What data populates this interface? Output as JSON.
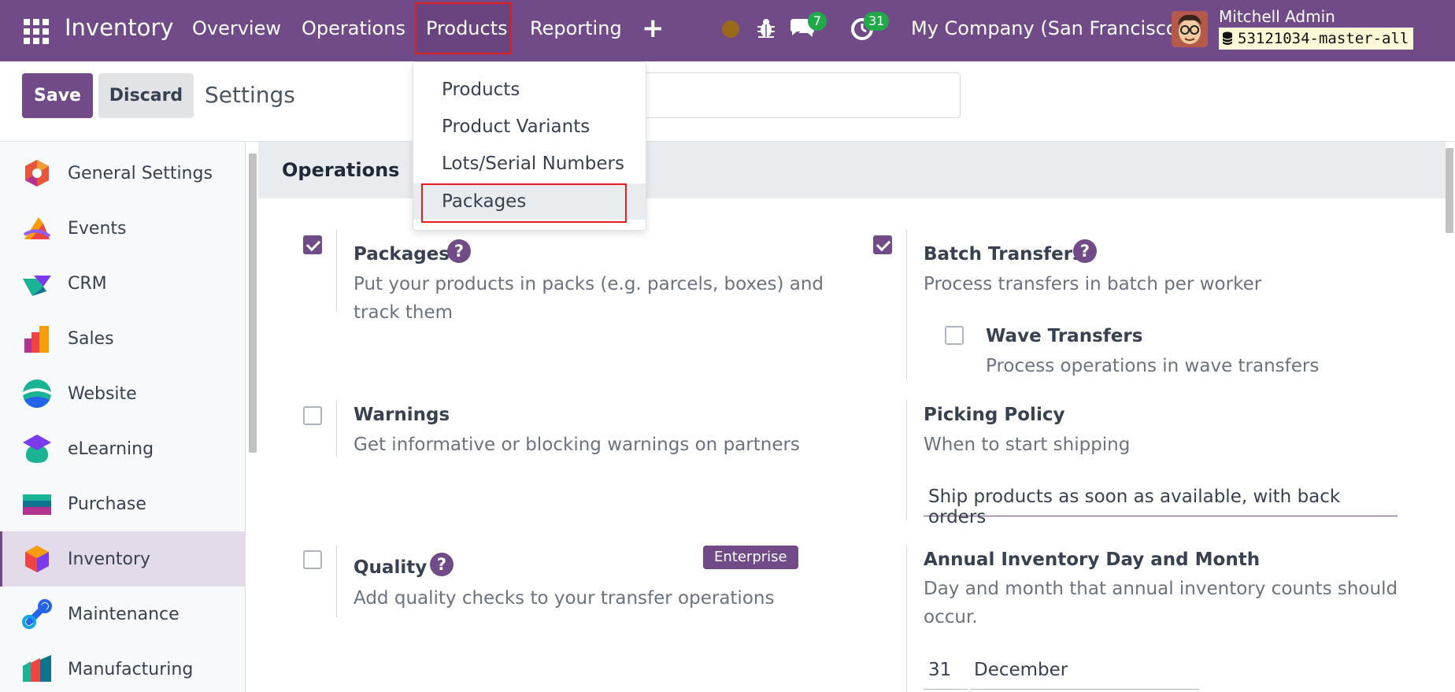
{
  "navbar": {
    "app_name": "Inventory",
    "menu": [
      "Overview",
      "Operations",
      "Products",
      "Reporting"
    ],
    "chat_count": "7",
    "activity_count": "31",
    "company": "My Company (San Francisco)",
    "user": "Mitchell Admin",
    "database": "53121034-master-all",
    "colors": {
      "brand": "#714B87",
      "badge": "#21a84a",
      "highlight": "#e02020"
    }
  },
  "control": {
    "save_label": "Save",
    "discard_label": "Discard",
    "title": "Settings"
  },
  "dropdown": {
    "items": [
      "Products",
      "Product Variants",
      "Lots/Serial Numbers",
      "Packages"
    ],
    "selected": "Packages"
  },
  "sidebar": {
    "items": [
      {
        "label": "General Settings",
        "icon": "general-settings-icon"
      },
      {
        "label": "Events",
        "icon": "events-icon"
      },
      {
        "label": "CRM",
        "icon": "crm-icon"
      },
      {
        "label": "Sales",
        "icon": "sales-icon"
      },
      {
        "label": "Website",
        "icon": "website-icon"
      },
      {
        "label": "eLearning",
        "icon": "elearning-icon"
      },
      {
        "label": "Purchase",
        "icon": "purchase-icon"
      },
      {
        "label": "Inventory",
        "icon": "inventory-icon"
      },
      {
        "label": "Maintenance",
        "icon": "maintenance-icon"
      },
      {
        "label": "Manufacturing",
        "icon": "manufacturing-icon"
      }
    ],
    "active": "Inventory"
  },
  "section": {
    "title": "Operations",
    "packages": {
      "title": "Packages",
      "desc_line1": "Put your products in packs (e.g. parcels, boxes) and",
      "desc_line2": "track them",
      "checked": true
    },
    "batch": {
      "title": "Batch Transfers",
      "desc": "Process transfers in batch per worker",
      "checked": true
    },
    "wave": {
      "title": "Wave Transfers",
      "desc": "Process operations in wave transfers",
      "checked": false
    },
    "warnings": {
      "title": "Warnings",
      "desc": "Get informative or blocking warnings on partners",
      "checked": false
    },
    "picking": {
      "title": "Picking Policy",
      "desc": "When to start shipping",
      "value": "Ship products as soon as available, with back orders"
    },
    "quality": {
      "title": "Quality",
      "desc": "Add quality checks to your transfer operations",
      "badge": "Enterprise",
      "checked": false
    },
    "annual": {
      "title": "Annual Inventory Day and Month",
      "desc_line1": "Day and month that annual inventory counts should",
      "desc_line2": "occur.",
      "day": "31",
      "month": "December"
    }
  }
}
